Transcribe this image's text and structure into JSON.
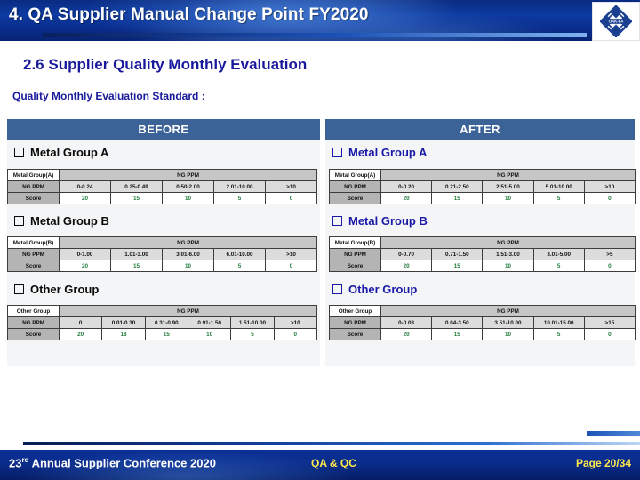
{
  "header": {
    "title": "4. QA Supplier Manual Change Point FY2020",
    "logo_text": "OAK-FA"
  },
  "slide": {
    "title": "2.6 Supplier Quality Monthly Evaluation",
    "subtitle": "Quality Monthly Evaluation Standard :"
  },
  "columns": {
    "before_label": "BEFORE",
    "after_label": "AFTER"
  },
  "groups": {
    "metal_a": "Metal Group A",
    "metal_b": "Metal Group B",
    "other": "Other Group"
  },
  "labels": {
    "ng_ppm": "NG PPM",
    "score": "Score",
    "metal_a_corner": "Metal Group(A)",
    "metal_b_corner": "Metal Group(B)",
    "other_corner": "Other Group"
  },
  "tables": {
    "before_metal_a": {
      "corner": "Metal Group(A)",
      "group_header": "NG PPM",
      "row_labels": [
        "NG PPM",
        "Score"
      ],
      "ranges": [
        "0-0.24",
        "0.25-0.49",
        "0.50-2.00",
        "2.01-10.00",
        ">10"
      ],
      "scores": [
        "20",
        "15",
        "10",
        "5",
        "0"
      ]
    },
    "after_metal_a": {
      "corner": "Metal Group(A)",
      "group_header": "NG PPM",
      "row_labels": [
        "NG PPM",
        "Score"
      ],
      "ranges": [
        "0-0.20",
        "0.21-2.50",
        "2.51-5.00",
        "5.01-10.00",
        ">10"
      ],
      "scores": [
        "20",
        "15",
        "10",
        "5",
        "0"
      ]
    },
    "before_metal_b": {
      "corner": "Metal Group(B)",
      "group_header": "NG PPM",
      "row_labels": [
        "NG PPM",
        "Score"
      ],
      "ranges": [
        "0-1.00",
        "1.01-3.00",
        "3.01-6.00",
        "6.01-10.00",
        ">10"
      ],
      "scores": [
        "20",
        "15",
        "10",
        "5",
        "0"
      ]
    },
    "after_metal_b": {
      "corner": "Metal Group(B)",
      "group_header": "NG PPM",
      "row_labels": [
        "NG PPM",
        "Score"
      ],
      "ranges": [
        "0-0.70",
        "0.71-1.50",
        "1.51-3.00",
        "3.01-5.00",
        ">5"
      ],
      "scores": [
        "20",
        "15",
        "10",
        "5",
        "0"
      ]
    },
    "before_other": {
      "corner": "Other Group",
      "group_header": "NG PPM",
      "row_labels": [
        "NG PPM",
        "Score"
      ],
      "ranges": [
        "0",
        "0.01-0.30",
        "0.31-0.90",
        "0.91-1.50",
        "1.51-10.00",
        ">10"
      ],
      "scores": [
        "20",
        "18",
        "15",
        "10",
        "5",
        "0"
      ]
    },
    "after_other": {
      "corner": "Other Group",
      "group_header": "NG PPM",
      "row_labels": [
        "NG PPM",
        "Score"
      ],
      "ranges": [
        "0-0.03",
        "0.04-3.50",
        "3.51-10.00",
        "10.01-15.00",
        ">15"
      ],
      "scores": [
        "20",
        "15",
        "10",
        "5",
        "0"
      ]
    }
  },
  "footer": {
    "left_prefix": "23",
    "left_sup": "rd",
    "left_rest": " Annual Supplier Conference 2020",
    "center": "QA & QC",
    "right": "Page 20/34"
  },
  "colors": {
    "header_blue": "#0d3aa0",
    "band_blue": "#3c6398",
    "title_navy": "#19199c",
    "score_green": "#1f7a3d",
    "footer_yellow": "#ffe94d"
  }
}
